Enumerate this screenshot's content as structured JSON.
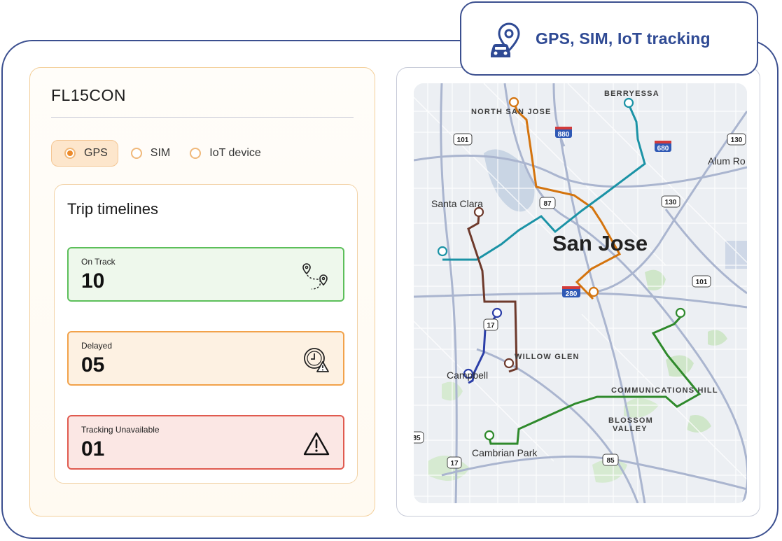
{
  "badge": {
    "text": "GPS, SIM, IoT tracking",
    "icon": "car-location-pin-icon"
  },
  "panel": {
    "title": "FL15CON",
    "radio_options": [
      {
        "label": "GPS",
        "selected": true
      },
      {
        "label": "SIM",
        "selected": false
      },
      {
        "label": "IoT device",
        "selected": false
      }
    ]
  },
  "timelines": {
    "title": "Trip timelines",
    "on_track": {
      "label": "On Track",
      "value": "10",
      "icon": "route-pins-icon"
    },
    "delayed": {
      "label": "Delayed",
      "value": "05",
      "icon": "clock-warning-icon"
    },
    "unavailable": {
      "label": "Tracking Unavailable",
      "value": "01",
      "icon": "warning-triangle-icon"
    }
  },
  "map": {
    "labels": {
      "north_san_jose": "NORTH SAN JOSE",
      "berryessa": "BERRYESSA",
      "alum_rock": "Alum Ro",
      "santa_clara": "Santa Clara",
      "san_jose": "San Jose",
      "willow_glen": "WILLOW GLEN",
      "campbell": "Campbell",
      "communications_hill": "COMMUNICATIONS HILL",
      "blossom_valley_1": "BLOSSOM",
      "blossom_valley_2": "VALLEY",
      "cambrian_park": "Cambrian Park"
    },
    "shields": [
      "101",
      "880",
      "680",
      "130",
      "87",
      "130",
      "101",
      "280",
      "17",
      "85",
      "17",
      "85"
    ],
    "route_colors": {
      "orange": "#d4740e",
      "teal": "#1b93a6",
      "brown": "#6e3a2c",
      "blue": "#2c3fa8",
      "green": "#2f8a2c"
    }
  }
}
